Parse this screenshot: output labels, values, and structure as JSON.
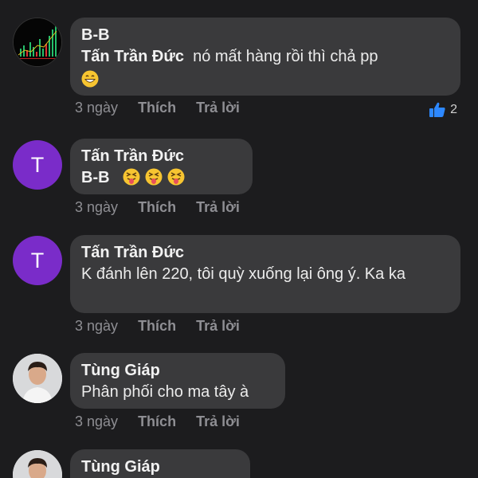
{
  "comments": [
    {
      "author": "B-B",
      "mention": "Tấn Trần Đức",
      "text": "nó mất hàng rồi thì chả pp",
      "emoji": [
        "grinning-face"
      ],
      "time": "3 ngày",
      "like_label": "Thích",
      "reply_label": "Trả lời",
      "reaction_count": "2",
      "avatar": "stock-chart-avatar"
    },
    {
      "author": "Tấn Trần Đức",
      "mention": "B-B",
      "emoji": [
        "squinting-tongue-face",
        "squinting-tongue-face",
        "squinting-tongue-face"
      ],
      "time": "3 ngày",
      "like_label": "Thích",
      "reply_label": "Trả lời",
      "avatar_letter": "T"
    },
    {
      "author": "Tấn Trần Đức",
      "text": "K đánh lên 220, tôi quỳ xuống lại ông ý. Ka ka",
      "time": "3 ngày",
      "like_label": "Thích",
      "reply_label": "Trả lời",
      "avatar_letter": "T"
    },
    {
      "author": "Tùng Giáp",
      "text": "Phân phối cho ma tây à",
      "time": "3 ngày",
      "like_label": "Thích",
      "reply_label": "Trả lời",
      "avatar": "person-photo-avatar"
    },
    {
      "author": "Tùng Giáp",
      "avatar": "person-photo-avatar"
    }
  ],
  "colors": {
    "background": "#1c1c1e",
    "bubble": "#3a3a3c",
    "avatar_letter_bg": "#7a2cc9",
    "like_icon": "#2d88ff",
    "meta_text": "#8e8e93"
  }
}
